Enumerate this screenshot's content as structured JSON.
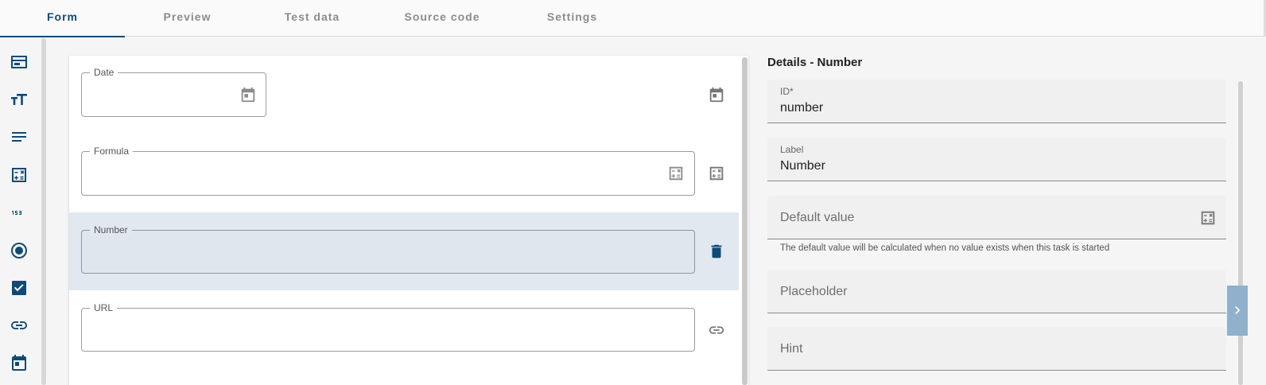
{
  "tabs": [
    {
      "label": "Form",
      "active": true
    },
    {
      "label": "Preview"
    },
    {
      "label": "Test data"
    },
    {
      "label": "Source code"
    },
    {
      "label": "Settings"
    }
  ],
  "sidebar": {
    "items": [
      {
        "icon": "container-icon"
      },
      {
        "icon": "text-size-icon"
      },
      {
        "icon": "text-lines-icon"
      },
      {
        "icon": "formula-icon"
      },
      {
        "icon": "number-123-icon"
      },
      {
        "icon": "radio-icon"
      },
      {
        "icon": "checkbox-icon"
      },
      {
        "icon": "link-icon"
      },
      {
        "icon": "calendar-icon"
      }
    ]
  },
  "form": {
    "fields": [
      {
        "label": "Date",
        "icon": "calendar-icon"
      },
      {
        "label": "Formula",
        "icon": "formula-icon"
      },
      {
        "label": "Number",
        "selected": true,
        "icon": "trash-icon"
      },
      {
        "label": "URL",
        "icon": "link-icon"
      }
    ]
  },
  "details": {
    "title": "Details - Number",
    "id_label": "ID*",
    "id_value": "number",
    "label_label": "Label",
    "label_value": "Number",
    "default_placeholder": "Default value",
    "default_hint": "The default value will be calculated when no value exists when this task is started",
    "placeholder_placeholder": "Placeholder",
    "hint_placeholder": "Hint"
  },
  "colors": {
    "accent": "#0e4a78",
    "selected_bg": "#e1e8ef"
  }
}
